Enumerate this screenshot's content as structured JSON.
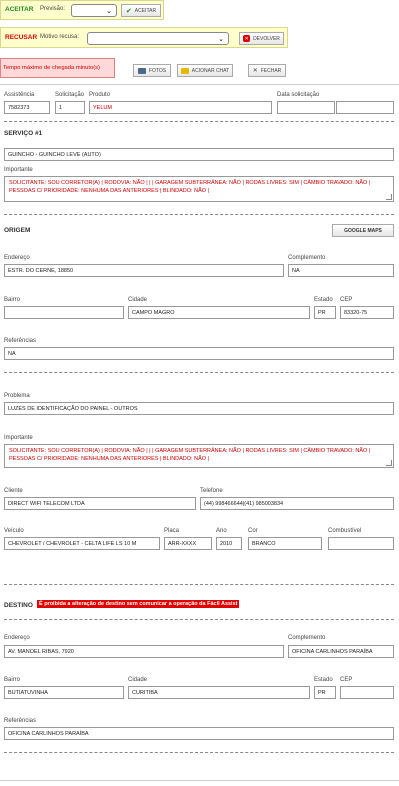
{
  "aceitar": {
    "title": "ACEITAR",
    "previsao_label": "Previsão:",
    "button": "ACEITAR"
  },
  "recusar": {
    "title": "RECUSAR",
    "motivo_label": "Motivo recusa:",
    "button": "DEVOLVER"
  },
  "tempo": {
    "text": "Tempo máximo de chegada minuto(s)"
  },
  "toolbar": {
    "fotos": "FOTOS",
    "acionar_chat": "ACIONAR CHAT",
    "fechar": "FECHAR"
  },
  "info": {
    "assistencia_label": "Assistência",
    "assistencia": "7582373",
    "solicitacao_label": "Solicitação",
    "solicitacao": "1",
    "produto_label": "Produto",
    "produto": "YELUM",
    "data_label": "Data solicitação",
    "data": "",
    "hora": ""
  },
  "servico": {
    "title": "SERVIÇO #1",
    "tipo": "GUINCHO - GUINCHO LEVE (AUTO)",
    "importante_label": "Importante",
    "importante": "SOLICITANTE: SOU CORRETOR(A) | RODOVIA: NÃO | | | GARAGEM SUBTERRÂNEA: NÃO | RODAS LIVRES: SIM | CÂMBIO TRAVADO: NÃO | PESSOAS C/ PRIORIDADE: NENHUMA DAS ANTERIORES | BLINDADO: NÃO |"
  },
  "origem": {
    "title": "ORIGEM",
    "maps_button": "GOOGLE MAPS",
    "endereco_label": "Endereço",
    "endereco": "ESTR. DO CERNE, 18850",
    "complemento_label": "Complemento",
    "complemento": "NA",
    "bairro_label": "Bairro",
    "bairro": "",
    "cidade_label": "Cidade",
    "cidade": "CAMPO MAGRO",
    "estado_label": "Estado",
    "estado": "PR",
    "cep_label": "CEP",
    "cep": "83320-75",
    "referencias_label": "Referências",
    "referencias": "NA"
  },
  "problema": {
    "label": "Problema",
    "value": "LUZES DE IDENTIFICAÇÃO DO PAINEL - OUTROS",
    "importante_label": "Importante",
    "importante": "SOLICITANTE: SOU CORRETOR(A) | RODOVIA: NÃO | | | GARAGEM SUBTERRÂNEA: NÃO | RODAS LIVRES: SIM | CÂMBIO TRAVADO: NÃO | PESSOAS C/ PRIORIDADE: NENHUMA DAS ANTERIORES | BLINDADO: NÃO |"
  },
  "cliente": {
    "cliente_label": "Cliente",
    "cliente": "DIRECT WIFI TELECOM LTDA",
    "telefone_label": "Telefone",
    "telefone": "(44) 998466644|(41) 985003834"
  },
  "veiculo": {
    "veiculo_label": "Veículo",
    "veiculo": "CHEVROLET / CHEVROLET - CELTA LIFE LS 10 M",
    "placa_label": "Placa",
    "placa": "ARR-XXXX",
    "ano_label": "Ano",
    "ano": "2010",
    "cor_label": "Cor",
    "cor": "BRANCO",
    "combustivel_label": "Combustível",
    "combustivel": ""
  },
  "destino": {
    "title": "DESTINO",
    "warning": "É proibida a alteração de destino sem comunicar a operação da Fácil Assist",
    "endereco_label": "Endereço",
    "endereco": "AV. MANOEL RIBAS, 7920",
    "complemento_label": "Complemento",
    "complemento": "OFICINA CARLINHOS PARAÍBA",
    "bairro_label": "Bairro",
    "bairro": "BUTIATUVINHA",
    "cidade_label": "Cidade",
    "cidade": "CURITIBA",
    "estado_label": "Estado",
    "estado": "PR",
    "cep_label": "CEP",
    "cep": "",
    "referencias_label": "Referências",
    "referencias": "OFICINA CARLINHOS PARAÍBA"
  },
  "colors": {
    "aceitar_bg": "#ffffcc",
    "aceitar_title": "#228b22",
    "recusar_title": "#e00000",
    "tempo_bg": "#ffd9d9",
    "warning_bg": "#e00000"
  },
  "icons": {
    "aceitar": "check-icon",
    "devolver": "x-icon",
    "fotos": "camera-icon",
    "chat": "folder-icon",
    "fechar": "close-icon"
  }
}
